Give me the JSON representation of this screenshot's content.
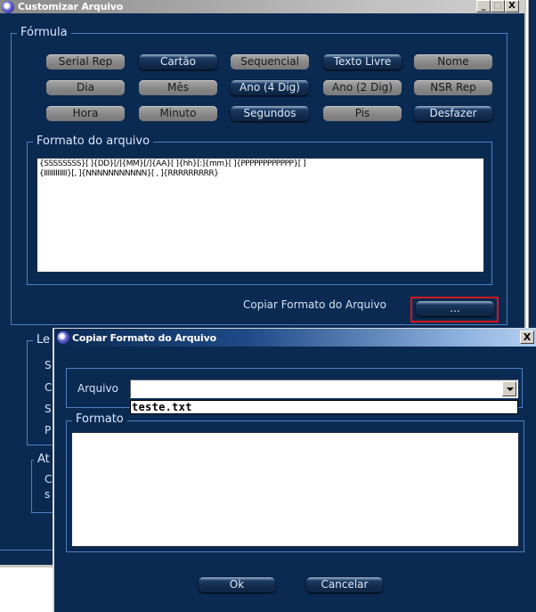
{
  "main_window": {
    "title": "Customizar Arquivo",
    "controls": {
      "minimize": "_",
      "maximize": "□",
      "close": "X"
    },
    "formula": {
      "legend": "Fórmula",
      "buttons": [
        {
          "label": "Serial Rep",
          "enabled": false
        },
        {
          "label": "Cartão",
          "enabled": true
        },
        {
          "label": "Sequencial",
          "enabled": false
        },
        {
          "label": "Texto Livre",
          "enabled": true
        },
        {
          "label": "Nome",
          "enabled": false
        },
        {
          "label": "Dia",
          "enabled": false
        },
        {
          "label": "Mês",
          "enabled": false
        },
        {
          "label": "Ano (4 Dig)",
          "enabled": true
        },
        {
          "label": "Ano (2 Dig)",
          "enabled": false
        },
        {
          "label": "NSR Rep",
          "enabled": false
        },
        {
          "label": "Hora",
          "enabled": false
        },
        {
          "label": "Minuto",
          "enabled": false
        },
        {
          "label": "Segundos",
          "enabled": true
        },
        {
          "label": "Pis",
          "enabled": false
        },
        {
          "label": "Desfazer",
          "enabled": true
        }
      ],
      "format_section": {
        "legend": "Formato do arquivo",
        "value_line1": "{SSSSSSSS}[ ]{DD}[/]{MM}[/]{AA}[ ]{hh}[:]{mm}[ ]{PPPPPPPPPPPP}[ ]",
        "value_line2": "{IIIIIIIIIIII}[, ]{NNNNNNNNNNN}[ , ]{RRRRRRRRR}"
      },
      "copy_label": "Copiar Formato do Arquivo",
      "copy_button": "..."
    },
    "partial_sections": {
      "section2_legend": "Le",
      "section2_letters": [
        "S",
        "C",
        "S",
        "P"
      ],
      "section3_legend": "At",
      "section3_letters": [
        "C",
        "s"
      ]
    }
  },
  "dialog": {
    "title": "Copiar Formato do Arquivo",
    "close": "X",
    "arquivo_label": "Arquivo",
    "arquivo_value": "",
    "dropdown_items": [
      "teste.txt"
    ],
    "formato_legend": "Formato",
    "formato_value": "",
    "ok_button": "Ok",
    "cancel_button": "Cancelar"
  },
  "colors": {
    "panel_bg": "#0b2a52",
    "border_accent": "#4f7fc2",
    "highlight": "#d4151d"
  }
}
